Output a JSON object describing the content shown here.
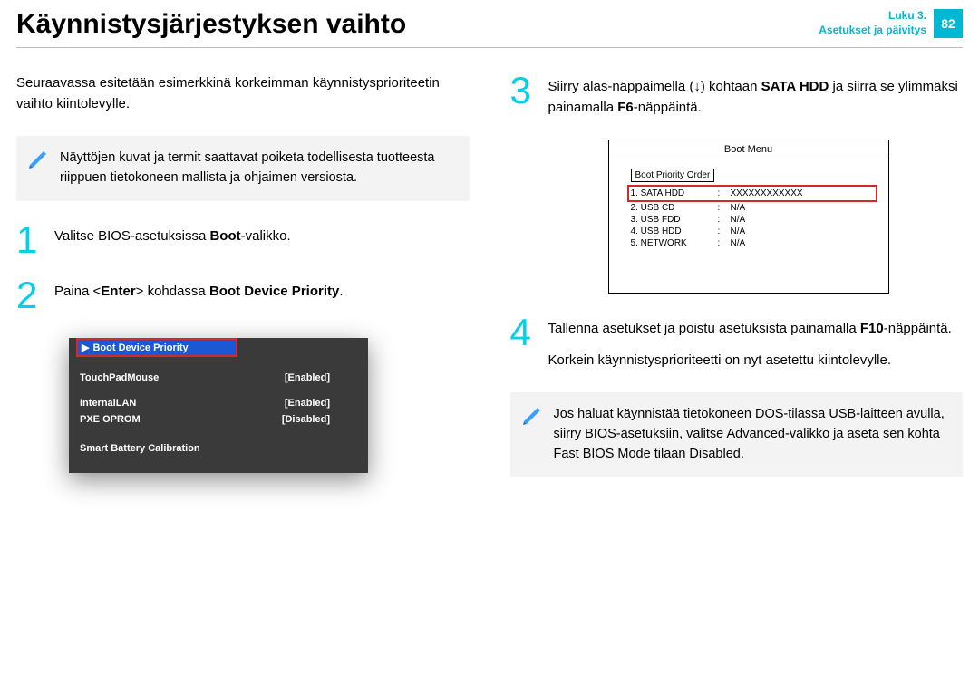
{
  "header": {
    "title": "Käynnistysjärjestyksen vaihto",
    "chapter_line1": "Luku 3.",
    "chapter_line2": "Asetukset ja päivitys",
    "page": "82"
  },
  "left": {
    "intro": "Seuraavassa esitetään esimerkkinä korkeimman käynnistysprioriteetin vaihto kiintolevylle.",
    "note": "Näyttöjen kuvat ja termit saattavat poiketa todellisesta tuotteesta riippuen tietokoneen mallista ja ohjaimen versiosta.",
    "step1_pre": "Valitse BIOS-asetuksissa ",
    "step1_bold": "Boot",
    "step1_post": "-valikko.",
    "step2_pre": "Paina <",
    "step2_b1": "Enter",
    "step2_mid": "> kohdassa ",
    "step2_b2": "Boot Device Priority",
    "step2_post": ".",
    "bios": {
      "highlight": "Boot Device Priority",
      "rows": [
        {
          "label": "TouchPadMouse",
          "value": "[Enabled]"
        },
        {
          "label": "InternalLAN",
          "value": "[Enabled]"
        },
        {
          "label": "PXE OPROM",
          "value": "[Disabled]"
        }
      ],
      "last": "Smart Battery Calibration"
    }
  },
  "right": {
    "step3_pre": "Siirry alas-näppäimellä (↓) kohtaan ",
    "step3_b1": "SATA HDD",
    "step3_mid": " ja siirrä se ylimmäksi painamalla ",
    "step3_b2": "F6",
    "step3_post": "-näppäintä.",
    "boot_menu": {
      "title": "Boot Menu",
      "order_label": "Boot Priority Order",
      "items": [
        {
          "idx": "1. SATA HDD",
          "val": "XXXXXXXXXXXX",
          "hl": true
        },
        {
          "idx": "2. USB CD",
          "val": "N/A",
          "hl": false
        },
        {
          "idx": "3. USB FDD",
          "val": "N/A",
          "hl": false
        },
        {
          "idx": "4. USB HDD",
          "val": "N/A",
          "hl": false
        },
        {
          "idx": "5. NETWORK",
          "val": "N/A",
          "hl": false
        }
      ]
    },
    "step4_pre": "Tallenna asetukset ja poistu asetuksista painamalla ",
    "step4_b1": "F10",
    "step4_post": "-näppäintä.",
    "extra": "Korkein käynnistysprioriteetti on nyt asetettu kiintolevylle.",
    "note_pre": "Jos haluat käynnistää tietokoneen ",
    "note_b1": "DOS",
    "note_mid1": "-tilassa ",
    "note_b2": "USB",
    "note_mid2": "-laitteen avulla, siirry BIOS-asetuksiin, valitse ",
    "note_b3": "Advanced",
    "note_mid3": "-valikko ja aseta sen kohta ",
    "note_b4": "Fast BIOS Mode",
    "note_mid4": " tilaan ",
    "note_b5": "Disabled",
    "note_post": "."
  },
  "nums": {
    "n1": "1",
    "n2": "2",
    "n3": "3",
    "n4": "4"
  }
}
